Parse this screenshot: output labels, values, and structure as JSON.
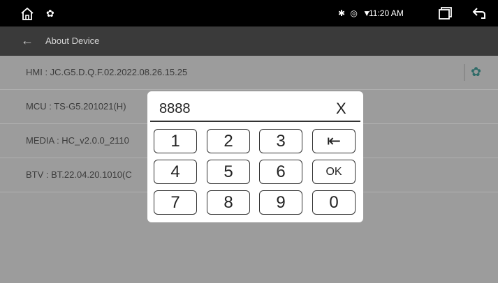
{
  "statusbar": {
    "time": "11:20 AM",
    "icons": [
      "home-icon",
      "gear-icon",
      "bluetooth-icon",
      "location-icon",
      "wifi-icon",
      "recents-icon",
      "back-icon"
    ]
  },
  "appbar": {
    "title": "About Device"
  },
  "rows": [
    {
      "label": "HMI : JC.G5.D.Q.F.02.2022.08.26.15.25"
    },
    {
      "label": "MCU : TS-G5.201021(H)"
    },
    {
      "label": "MEDIA : HC_v2.0.0_2110"
    },
    {
      "label": "BTV : BT.22.04.20.1010(C"
    }
  ],
  "dialog": {
    "entry": "8888",
    "close": "X",
    "keys": [
      "1",
      "2",
      "3",
      "⇤",
      "4",
      "5",
      "6",
      "OK",
      "7",
      "8",
      "9",
      "0"
    ]
  },
  "colors": {
    "background": "#9c9c9c",
    "appbar": "#3a3a3a",
    "statusbar": "#000000",
    "accent": "#2f6b68"
  }
}
